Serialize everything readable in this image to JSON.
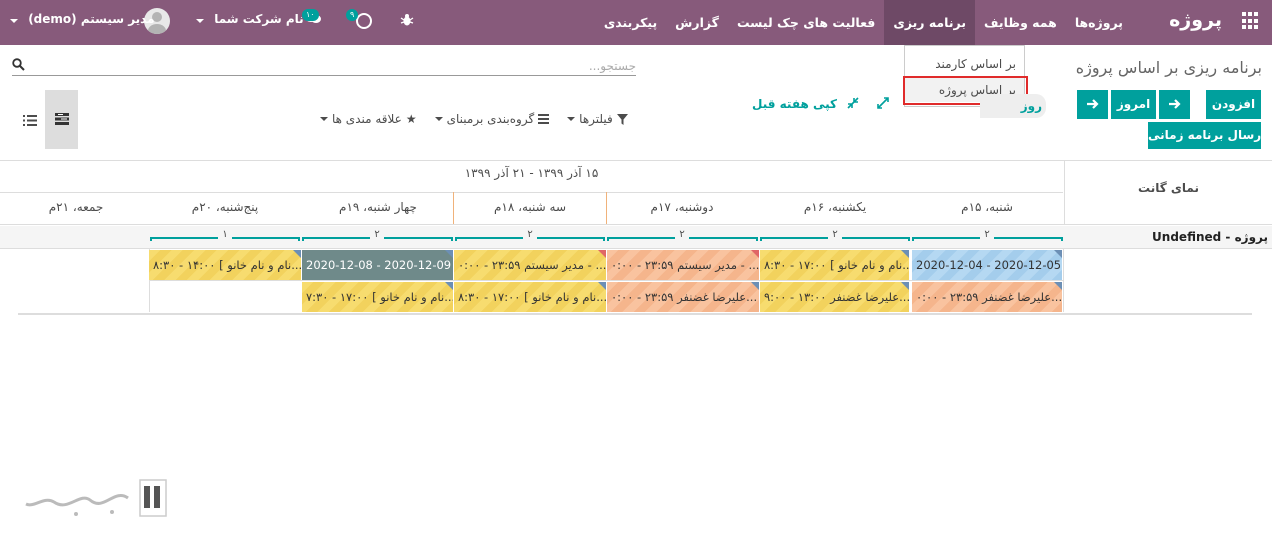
{
  "navbar": {
    "brand": "پروژه",
    "menu": [
      "پروژه‌ها",
      "همه وظایف",
      "برنامه ریزی",
      "فعالیت های چک لیست",
      "گزارش",
      "پیکربندی"
    ],
    "active_menu": "برنامه ریزی",
    "company": "نام شرکت شما",
    "user": "مدیر سیستم (demo)",
    "activity_badge": "۹",
    "chat_badge": "۱۰",
    "accent": "#875a7b"
  },
  "dropdown": {
    "item1": "بر اساس کارمند",
    "item2": "بر اساس پروژه"
  },
  "breadcrumb": "برنامه ریزی بر اساس پروژه",
  "search": {
    "placeholder": "جستجو..."
  },
  "buttons": {
    "add": "افزودن",
    "send": "ارسال برنامه زمانی",
    "today": "امروز",
    "next": "🡪",
    "prev": "🡪",
    "scale": "روز",
    "copy_week": "کپی هفته قبل"
  },
  "filters": {
    "filters": "فیلترها",
    "groupby": "گروه‌بندی برمبنای",
    "favorites": "علاقه مندی ها"
  },
  "gantt": {
    "title": "نمای گانت",
    "range": "۱۵ آذر ۱۳۹۹ - ۲۱ آذر ۱۳۹۹",
    "days": [
      "شنبه، ۱۵م",
      "یکشنبه، ۱۶م",
      "دوشنبه، ۱۷م",
      "سه شنبه، ۱۸م",
      "چهار شنبه، ۱۹م",
      "پنج‌شنبه، ۲۰م",
      "جمعه، ۲۱م"
    ],
    "group_label": "Undefined - پروژه",
    "counts": [
      "۲",
      "۲",
      "۲",
      "۲",
      "۲",
      "۱"
    ],
    "tasks": [
      "2020-12-04 - 2020-12-05 نق...",
      "۸:۳۰ - ۱۷:۰۰ [ نام و نام خانو...",
      "۰:۰۰ - ۲۳:۵۹ مدیر سیستم - ...",
      "۰:۰۰ - ۲۳:۵۹ مدیر سیستم - ...",
      "2020-12-08 - 2020-12-09 مدیر ...",
      "۸:۳۰ - ۱۴:۰۰ [ نام و نام خانو...",
      "۰:۰۰ - ۲۳:۵۹ علیرضا غضنفر...",
      "۹:۰۰ - ۱۳:۰۰ علیرضا غضنفر...",
      "۰:۰۰ - ۲۳:۵۹ علیرضا غضنفر...",
      "۸:۳۰ - ۱۷:۰۰ [ نام و نام خانو...",
      "۷:۳۰ - ۱۷:۰۰ [ نام و نام خانو..."
    ]
  }
}
